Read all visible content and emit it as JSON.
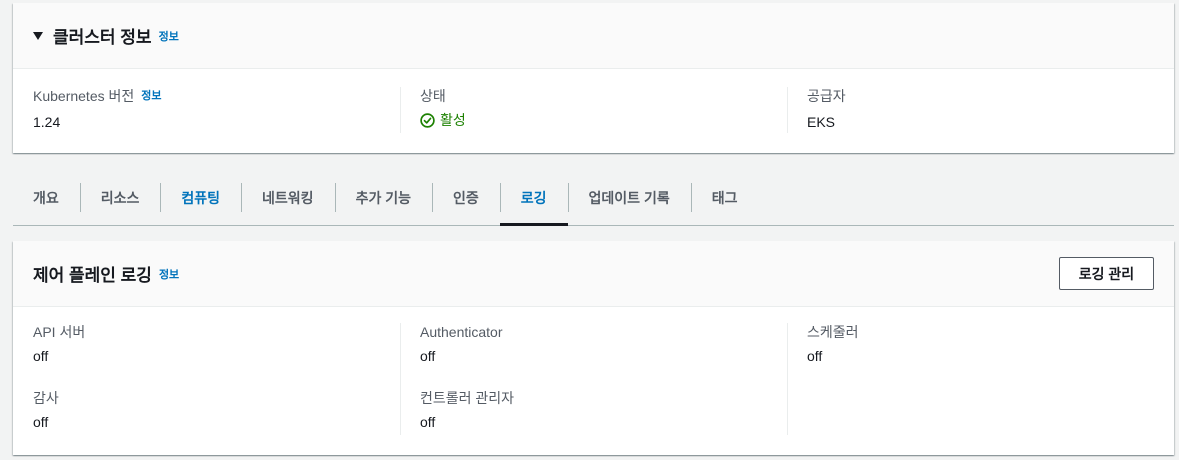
{
  "cluster_info": {
    "title": "클러스터 정보",
    "info_link": "정보",
    "fields": [
      {
        "label": "Kubernetes 버전",
        "info_link": "정보",
        "value": "1.24"
      },
      {
        "label": "상태",
        "value": "활성",
        "status_color": "#1d8102"
      },
      {
        "label": "공급자",
        "value": "EKS"
      }
    ]
  },
  "tabs": [
    {
      "label": "개요"
    },
    {
      "label": "리소스"
    },
    {
      "label": "컴퓨팅"
    },
    {
      "label": "네트워킹"
    },
    {
      "label": "추가 기능"
    },
    {
      "label": "인증"
    },
    {
      "label": "로깅",
      "active": true
    },
    {
      "label": "업데이트 기록"
    },
    {
      "label": "태그"
    }
  ],
  "control_plane_logging": {
    "title": "제어 플레인 로깅",
    "info_link": "정보",
    "manage_button": "로깅 관리",
    "items": [
      {
        "label": "API 서버",
        "value": "off"
      },
      {
        "label": "감사",
        "value": "off"
      },
      {
        "label": "Authenticator",
        "value": "off"
      },
      {
        "label": "컨트롤러 관리자",
        "value": "off"
      },
      {
        "label": "스케줄러",
        "value": "off"
      }
    ]
  },
  "colors": {
    "link": "#0073bb",
    "success": "#1d8102",
    "text": "#16191f",
    "label": "#545b64"
  }
}
